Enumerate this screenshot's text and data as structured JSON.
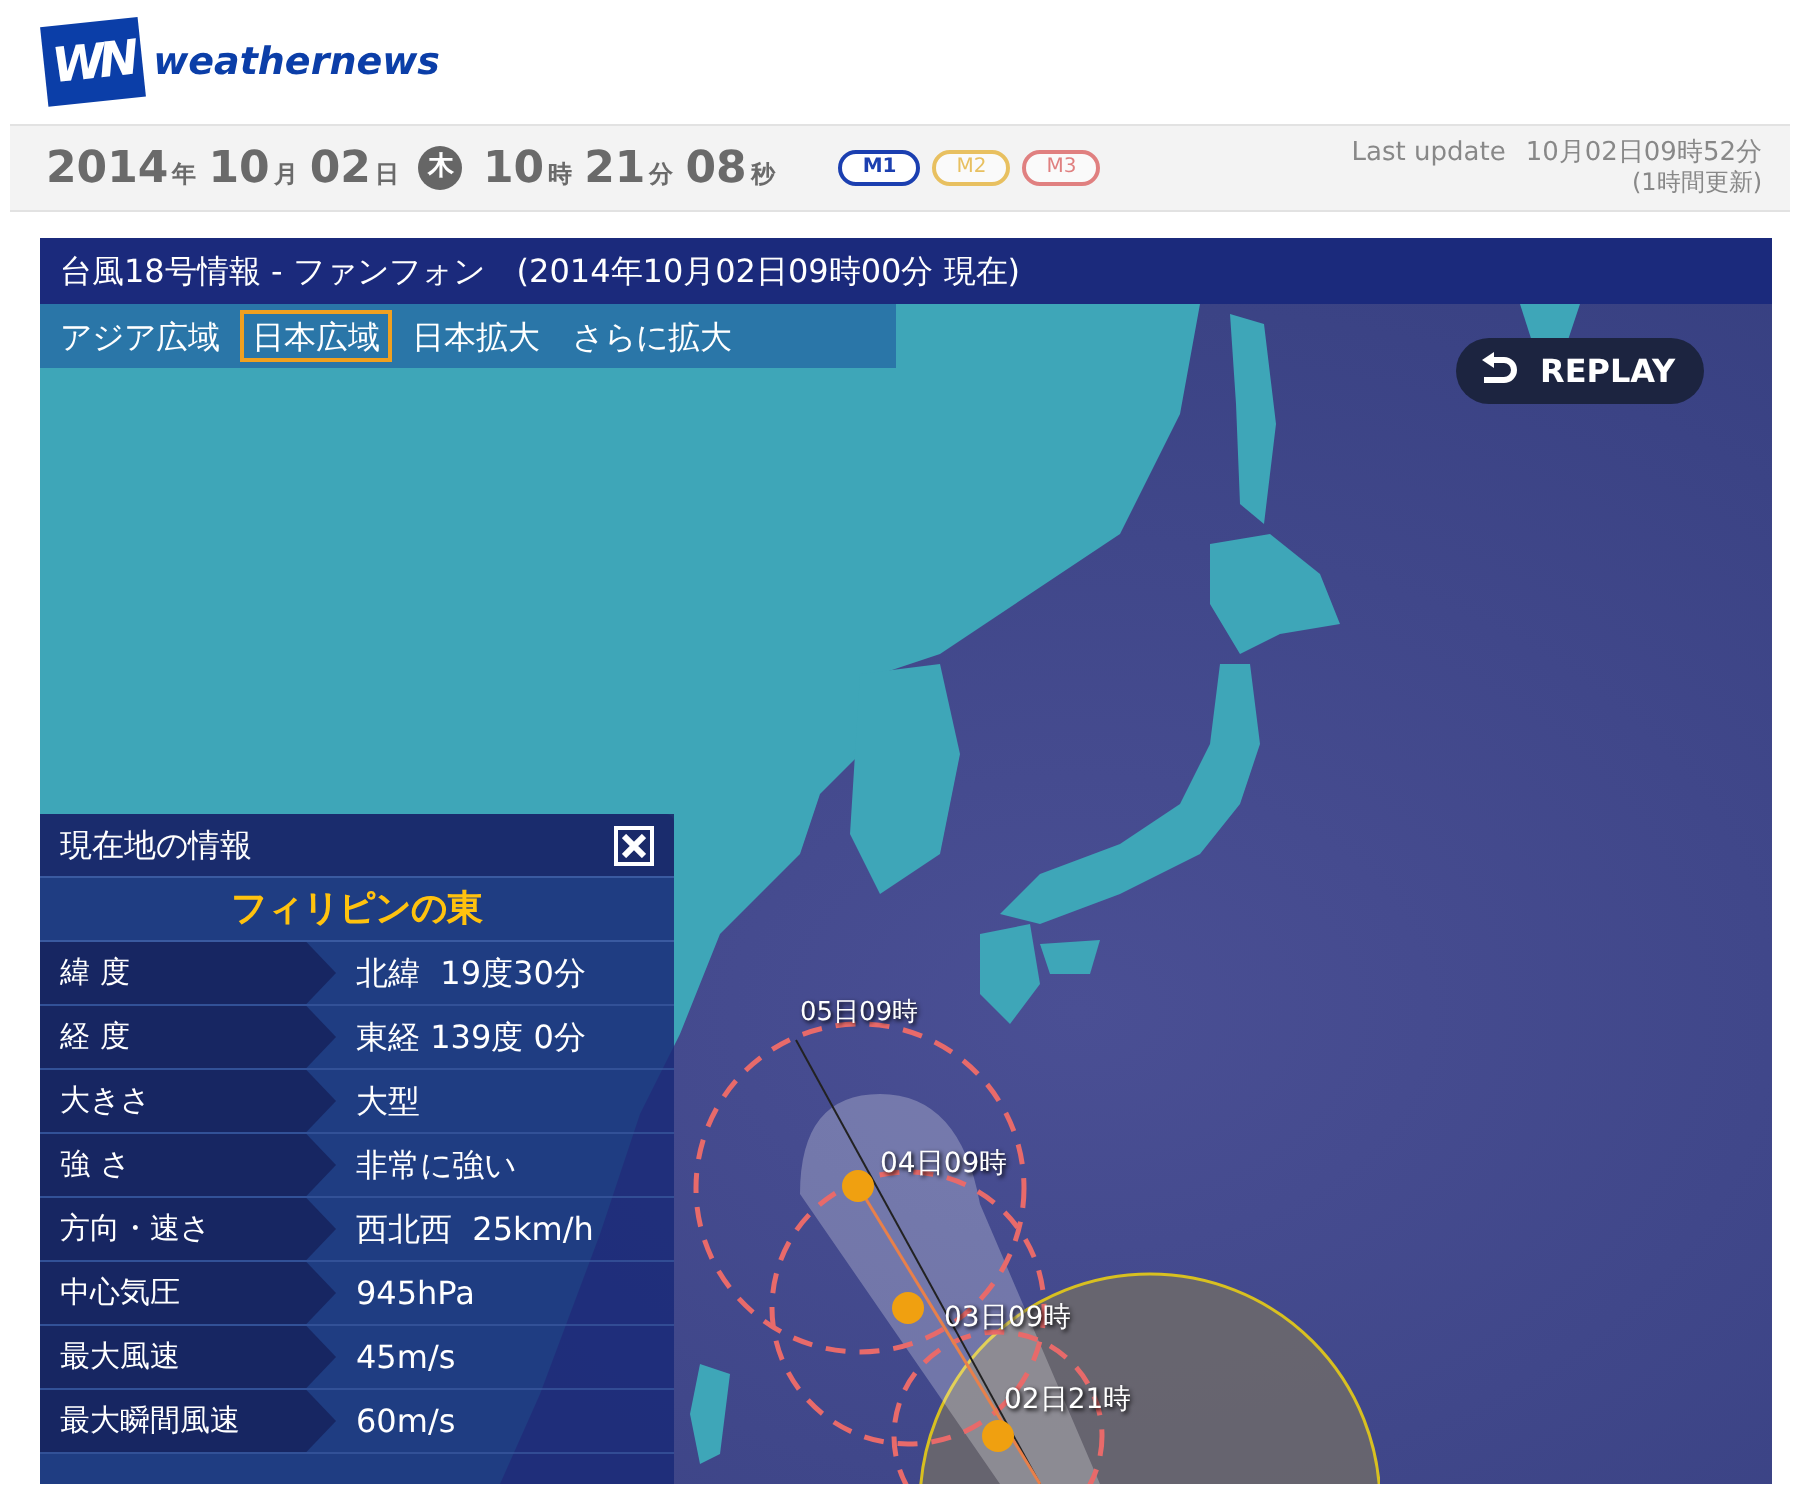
{
  "logo": {
    "mark": "WN",
    "text": "weathernews"
  },
  "date_bar": {
    "parts": [
      {
        "value": "2014",
        "unit": "年"
      },
      {
        "value": "10",
        "unit": "月"
      },
      {
        "value": "02",
        "unit": "日"
      }
    ],
    "weekday": "木",
    "time_parts": [
      {
        "value": "10",
        "unit": "時"
      },
      {
        "value": "21",
        "unit": "分"
      },
      {
        "value": "08",
        "unit": "秒"
      }
    ],
    "modes": [
      {
        "label": "M1",
        "selected": true,
        "color": "#1b3fb0"
      },
      {
        "label": "M2",
        "selected": false,
        "color": "#e8c060"
      },
      {
        "label": "M3",
        "selected": false,
        "color": "#e08080"
      }
    ],
    "last_update": {
      "label": "Last update",
      "value": "10月02日09時52分",
      "note": "(1時間更新)"
    }
  },
  "map_panel": {
    "title": "台風18号情報 - ファンフォン　(2014年10月02日09時00分 現在)",
    "tabs": [
      {
        "label": "アジア広域",
        "selected": false
      },
      {
        "label": "日本広域",
        "selected": true
      },
      {
        "label": "日本拡大",
        "selected": false
      },
      {
        "label": "さらに拡大",
        "selected": false
      }
    ],
    "replay_button": {
      "label": "REPLAY"
    },
    "track_points": [
      {
        "label": "05日09時",
        "kind": "end"
      },
      {
        "label": "04日09時",
        "kind": "dot"
      },
      {
        "label": "03日09時",
        "kind": "dot"
      },
      {
        "label": "02日21時",
        "kind": "dot"
      }
    ],
    "info_panel": {
      "title": "現在地の情報",
      "location": "フィリピンの東",
      "rows": [
        {
          "label": "緯 度",
          "value": "北緯  19度30分"
        },
        {
          "label": "経 度",
          "value": "東経 139度 0分"
        },
        {
          "label": "大きさ",
          "value": "大型"
        },
        {
          "label": "強 さ",
          "value": "非常に強い"
        },
        {
          "label": "方向・速さ",
          "value": "西北西  25km/h"
        },
        {
          "label": "中心気圧",
          "value": "945hPa"
        },
        {
          "label": "最大風速",
          "value": "45m/s"
        },
        {
          "label": "最大瞬間風速",
          "value": "60m/s"
        }
      ]
    }
  }
}
